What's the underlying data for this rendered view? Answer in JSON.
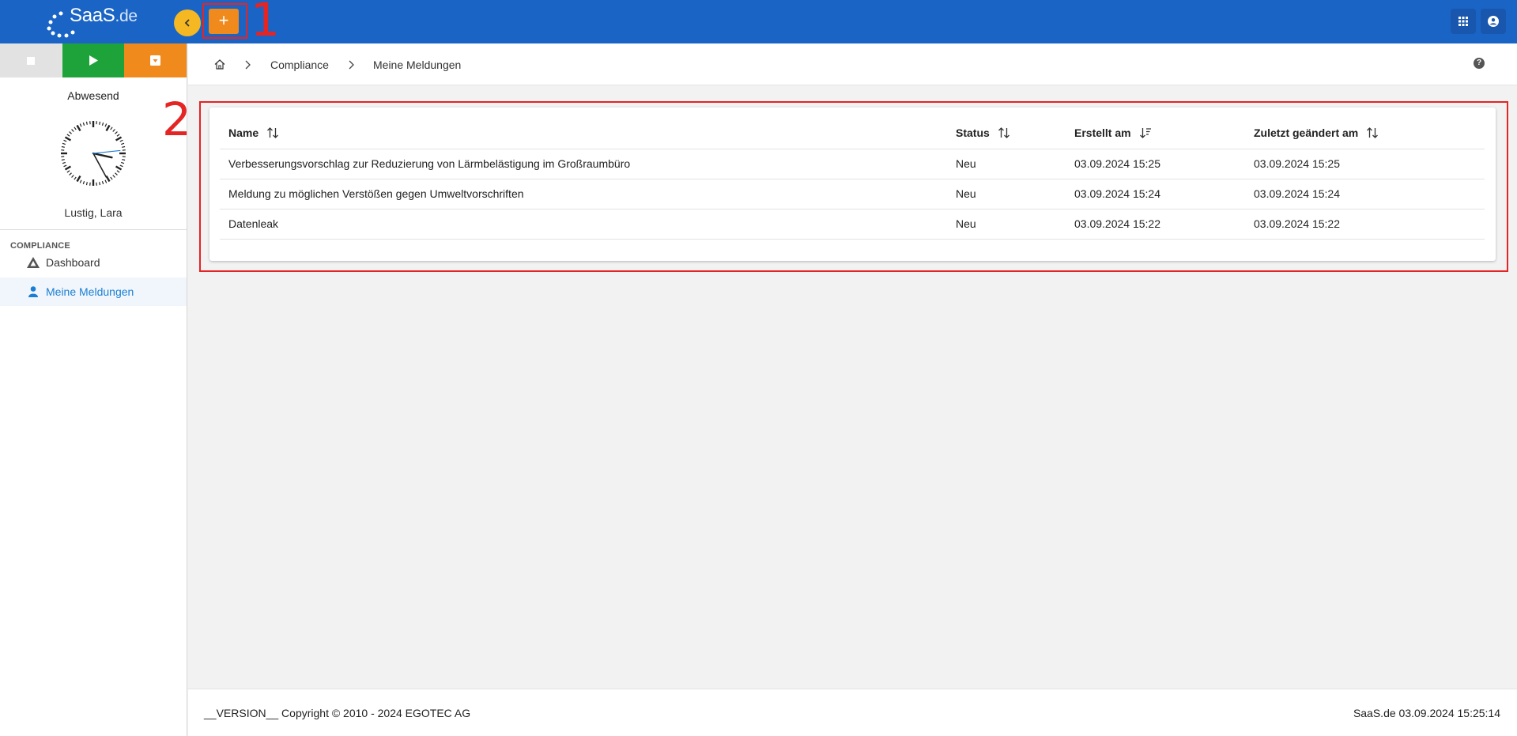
{
  "header": {
    "logo_text": "SaaS",
    "logo_domain": ".de",
    "add_label": "+",
    "annotation_1": "1",
    "icons": [
      "grid-icon",
      "account-icon",
      "chevron-left-icon"
    ]
  },
  "sidebar": {
    "status": "Abwesend",
    "user_name": "Lustig, Lara",
    "section": "COMPLIANCE",
    "items": [
      {
        "label": "Dashboard",
        "icon": "dashboard-icon"
      },
      {
        "label": "Meine Meldungen",
        "icon": "person-icon"
      }
    ],
    "clock": {
      "hour": 15,
      "minute": 25,
      "second": 14
    }
  },
  "breadcrumb": {
    "items": [
      "Compliance",
      "Meine Meldungen"
    ],
    "icons": [
      "home-icon",
      "chevron-right-icon",
      "help-icon"
    ]
  },
  "annotation_2": "2",
  "table": {
    "columns": [
      "Name",
      "Status",
      "Erstellt am",
      "Zuletzt geändert am"
    ],
    "rows": [
      {
        "name": "Verbesserungsvorschlag zur Reduzierung von Lärmbelästigung im Großraumbüro",
        "status": "Neu",
        "created": "03.09.2024 15:25",
        "modified": "03.09.2024 15:25"
      },
      {
        "name": "Meldung zu möglichen Verstößen gegen Umweltvorschriften",
        "status": "Neu",
        "created": "03.09.2024 15:24",
        "modified": "03.09.2024 15:24"
      },
      {
        "name": "Datenleak",
        "status": "Neu",
        "created": "03.09.2024 15:22",
        "modified": "03.09.2024 15:22"
      }
    ]
  },
  "footer": {
    "left": "__VERSION__ Copyright © 2010 - 2024 EGOTEC AG",
    "right": "SaaS.de  03.09.2024 15:25:14"
  },
  "colors": {
    "topbar": "#1a64c5",
    "accent_orange": "#f08a1c",
    "accent_yellow": "#f5b822",
    "play_green": "#1ea33a",
    "annotation_red": "#e52424",
    "active_link": "#1a7fd4"
  }
}
